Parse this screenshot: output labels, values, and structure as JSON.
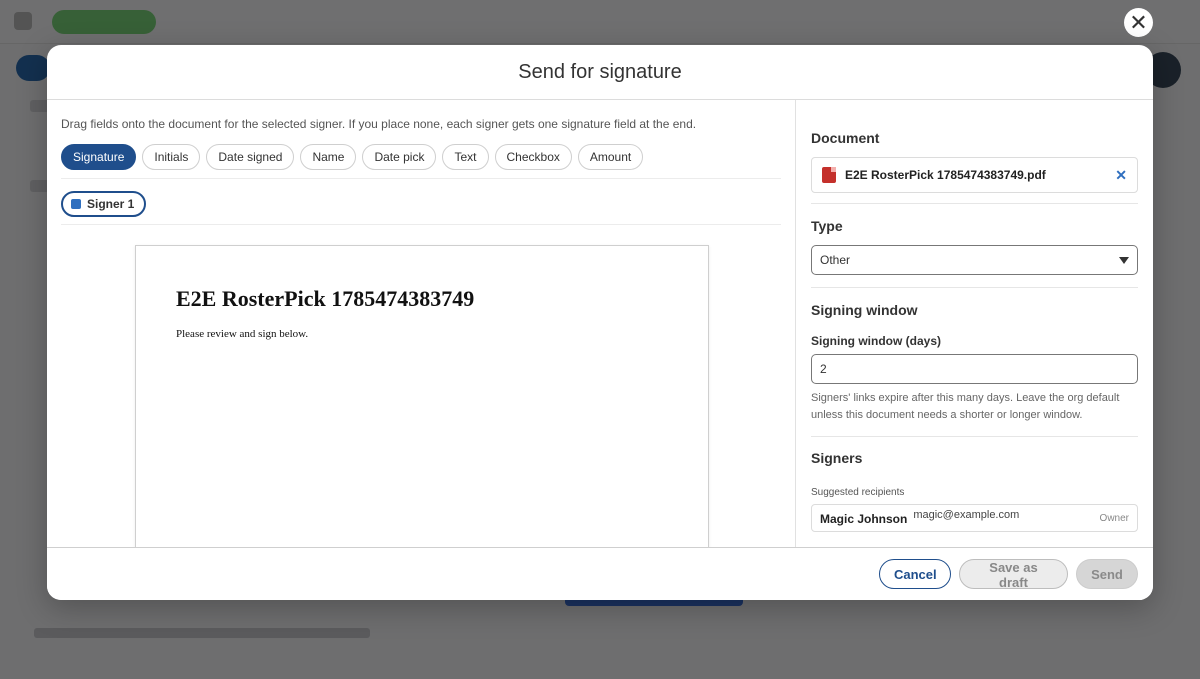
{
  "modal": {
    "title": "Send for signature"
  },
  "fields": {
    "instructions": "Drag fields onto the document for the selected signer. If you place none, each signer gets one signature field at the end.",
    "types": [
      "Signature",
      "Initials",
      "Date signed",
      "Name",
      "Date pick",
      "Text",
      "Checkbox",
      "Amount"
    ],
    "active": "Signature"
  },
  "signers_bar": {
    "signer_label": "Signer 1",
    "signer_color": "#2f6fbf"
  },
  "document_preview": {
    "title": "E2E RosterPick 1785474383749",
    "body": "Please review and sign below."
  },
  "sidebar": {
    "document_heading": "Document",
    "file_name": "E2E RosterPick 1785474383749.pdf",
    "type_heading": "Type",
    "type_value": "Other",
    "signing_window_heading": "Signing window",
    "signing_window_label": "Signing window (days)",
    "signing_window_value": "2",
    "signing_window_help": "Signers' links expire after this many days. Leave the org default unless this document needs a shorter or longer window.",
    "signers_heading": "Signers",
    "suggested_label": "Suggested recipients",
    "recipients": [
      {
        "name": "Magic Johnson",
        "email": "magic@example.com",
        "role": "Owner"
      }
    ]
  },
  "footer": {
    "cancel": "Cancel",
    "save_draft": "Save as draft",
    "send": "Send"
  },
  "colors": {
    "accent": "#1f4e8c",
    "pdf_red": "#c4302b"
  }
}
